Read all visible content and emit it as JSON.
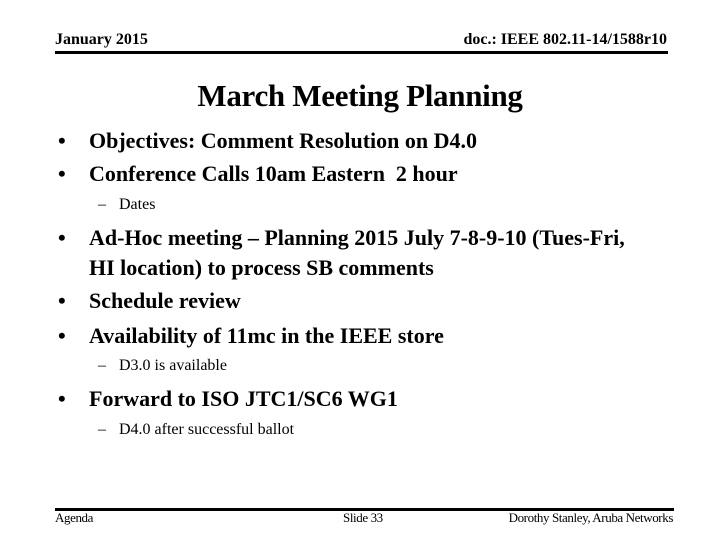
{
  "header": {
    "date": "January 2015",
    "doc_id": "doc.: IEEE 802.11-14/1588r10"
  },
  "slide": {
    "title": "March Meeting Planning",
    "bullet_glyph": "•",
    "dash_glyph": "–",
    "items": [
      {
        "text": "Objectives: Comment Resolution on D4.0"
      },
      {
        "text": "Conference Calls 10am Eastern  2 hour",
        "subitems": [
          "Dates"
        ]
      },
      {
        "text": "Ad-Hoc meeting – Planning 2015 July 7-8-9-10 (Tues-Fri, HI location) to process SB comments"
      },
      {
        "text": "Schedule review"
      },
      {
        "text": "Availability of 11mc in the IEEE store",
        "subitems": [
          "D3.0 is available"
        ]
      },
      {
        "text": "Forward to ISO JTC1/SC6 WG1",
        "subitems": [
          "D4.0 after successful ballot"
        ]
      }
    ]
  },
  "footer": {
    "section": "Agenda",
    "slide_number": "Slide 33",
    "author": "Dorothy Stanley, Aruba Networks"
  }
}
